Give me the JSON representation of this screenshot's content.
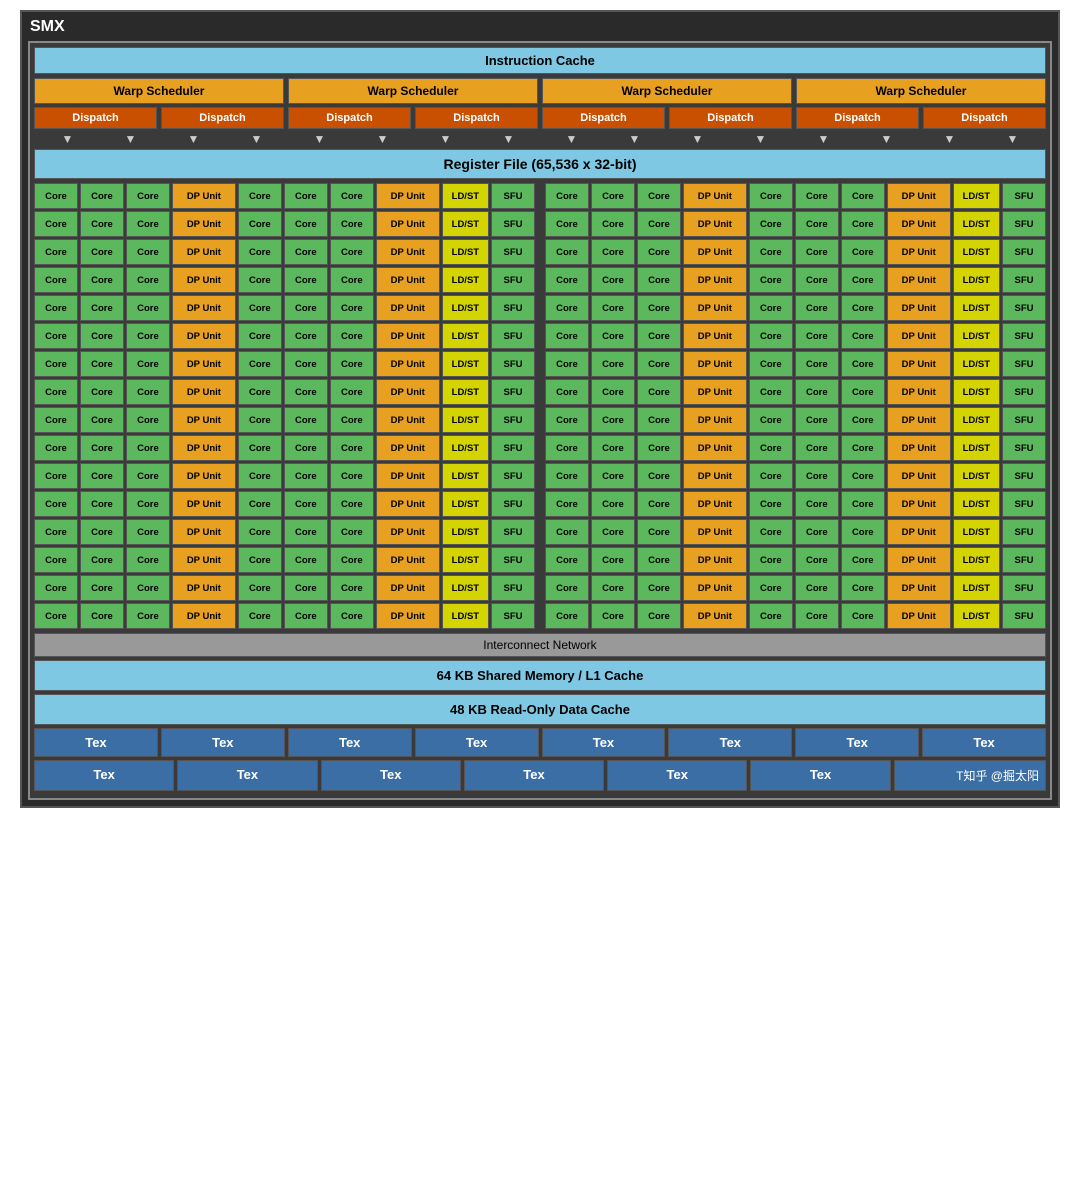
{
  "title": "SMX",
  "instruction_cache": "Instruction Cache",
  "warp_schedulers": [
    "Warp Scheduler",
    "Warp Scheduler",
    "Warp Scheduler",
    "Warp Scheduler"
  ],
  "dispatch_units": [
    "Dispatch",
    "Dispatch",
    "Dispatch",
    "Dispatch",
    "Dispatch",
    "Dispatch",
    "Dispatch",
    "Dispatch"
  ],
  "register_file": "Register File (65,536 x 32-bit)",
  "row_pattern": [
    "Core",
    "Core",
    "Core",
    "DP Unit",
    "Core",
    "Core",
    "Core",
    "DP Unit",
    "LD/ST",
    "SFU",
    "Core",
    "Core",
    "Core",
    "DP Unit",
    "Core",
    "Core",
    "Core",
    "DP Unit",
    "LD/ST",
    "SFU"
  ],
  "num_rows": 16,
  "interconnect": "Interconnect Network",
  "shared_memory": "64 KB Shared Memory / L1 Cache",
  "readonly_cache": "48 KB Read-Only Data Cache",
  "tex_row1": [
    "Tex",
    "Tex",
    "Tex",
    "Tex",
    "Tex",
    "Tex",
    "Tex",
    "Tex"
  ],
  "tex_row2": [
    "Tex",
    "Tex",
    "Tex",
    "Tex",
    "Tex",
    "Tex",
    "T知乎 @掘太阳"
  ],
  "colors": {
    "core": "#5cb85c",
    "dp": "#e8a020",
    "ldst": "#d4d400",
    "sfu": "#5cb85c",
    "header": "#7ec8e3",
    "warp": "#e8a020",
    "dispatch": "#c85000",
    "tex": "#3a6ea5"
  }
}
